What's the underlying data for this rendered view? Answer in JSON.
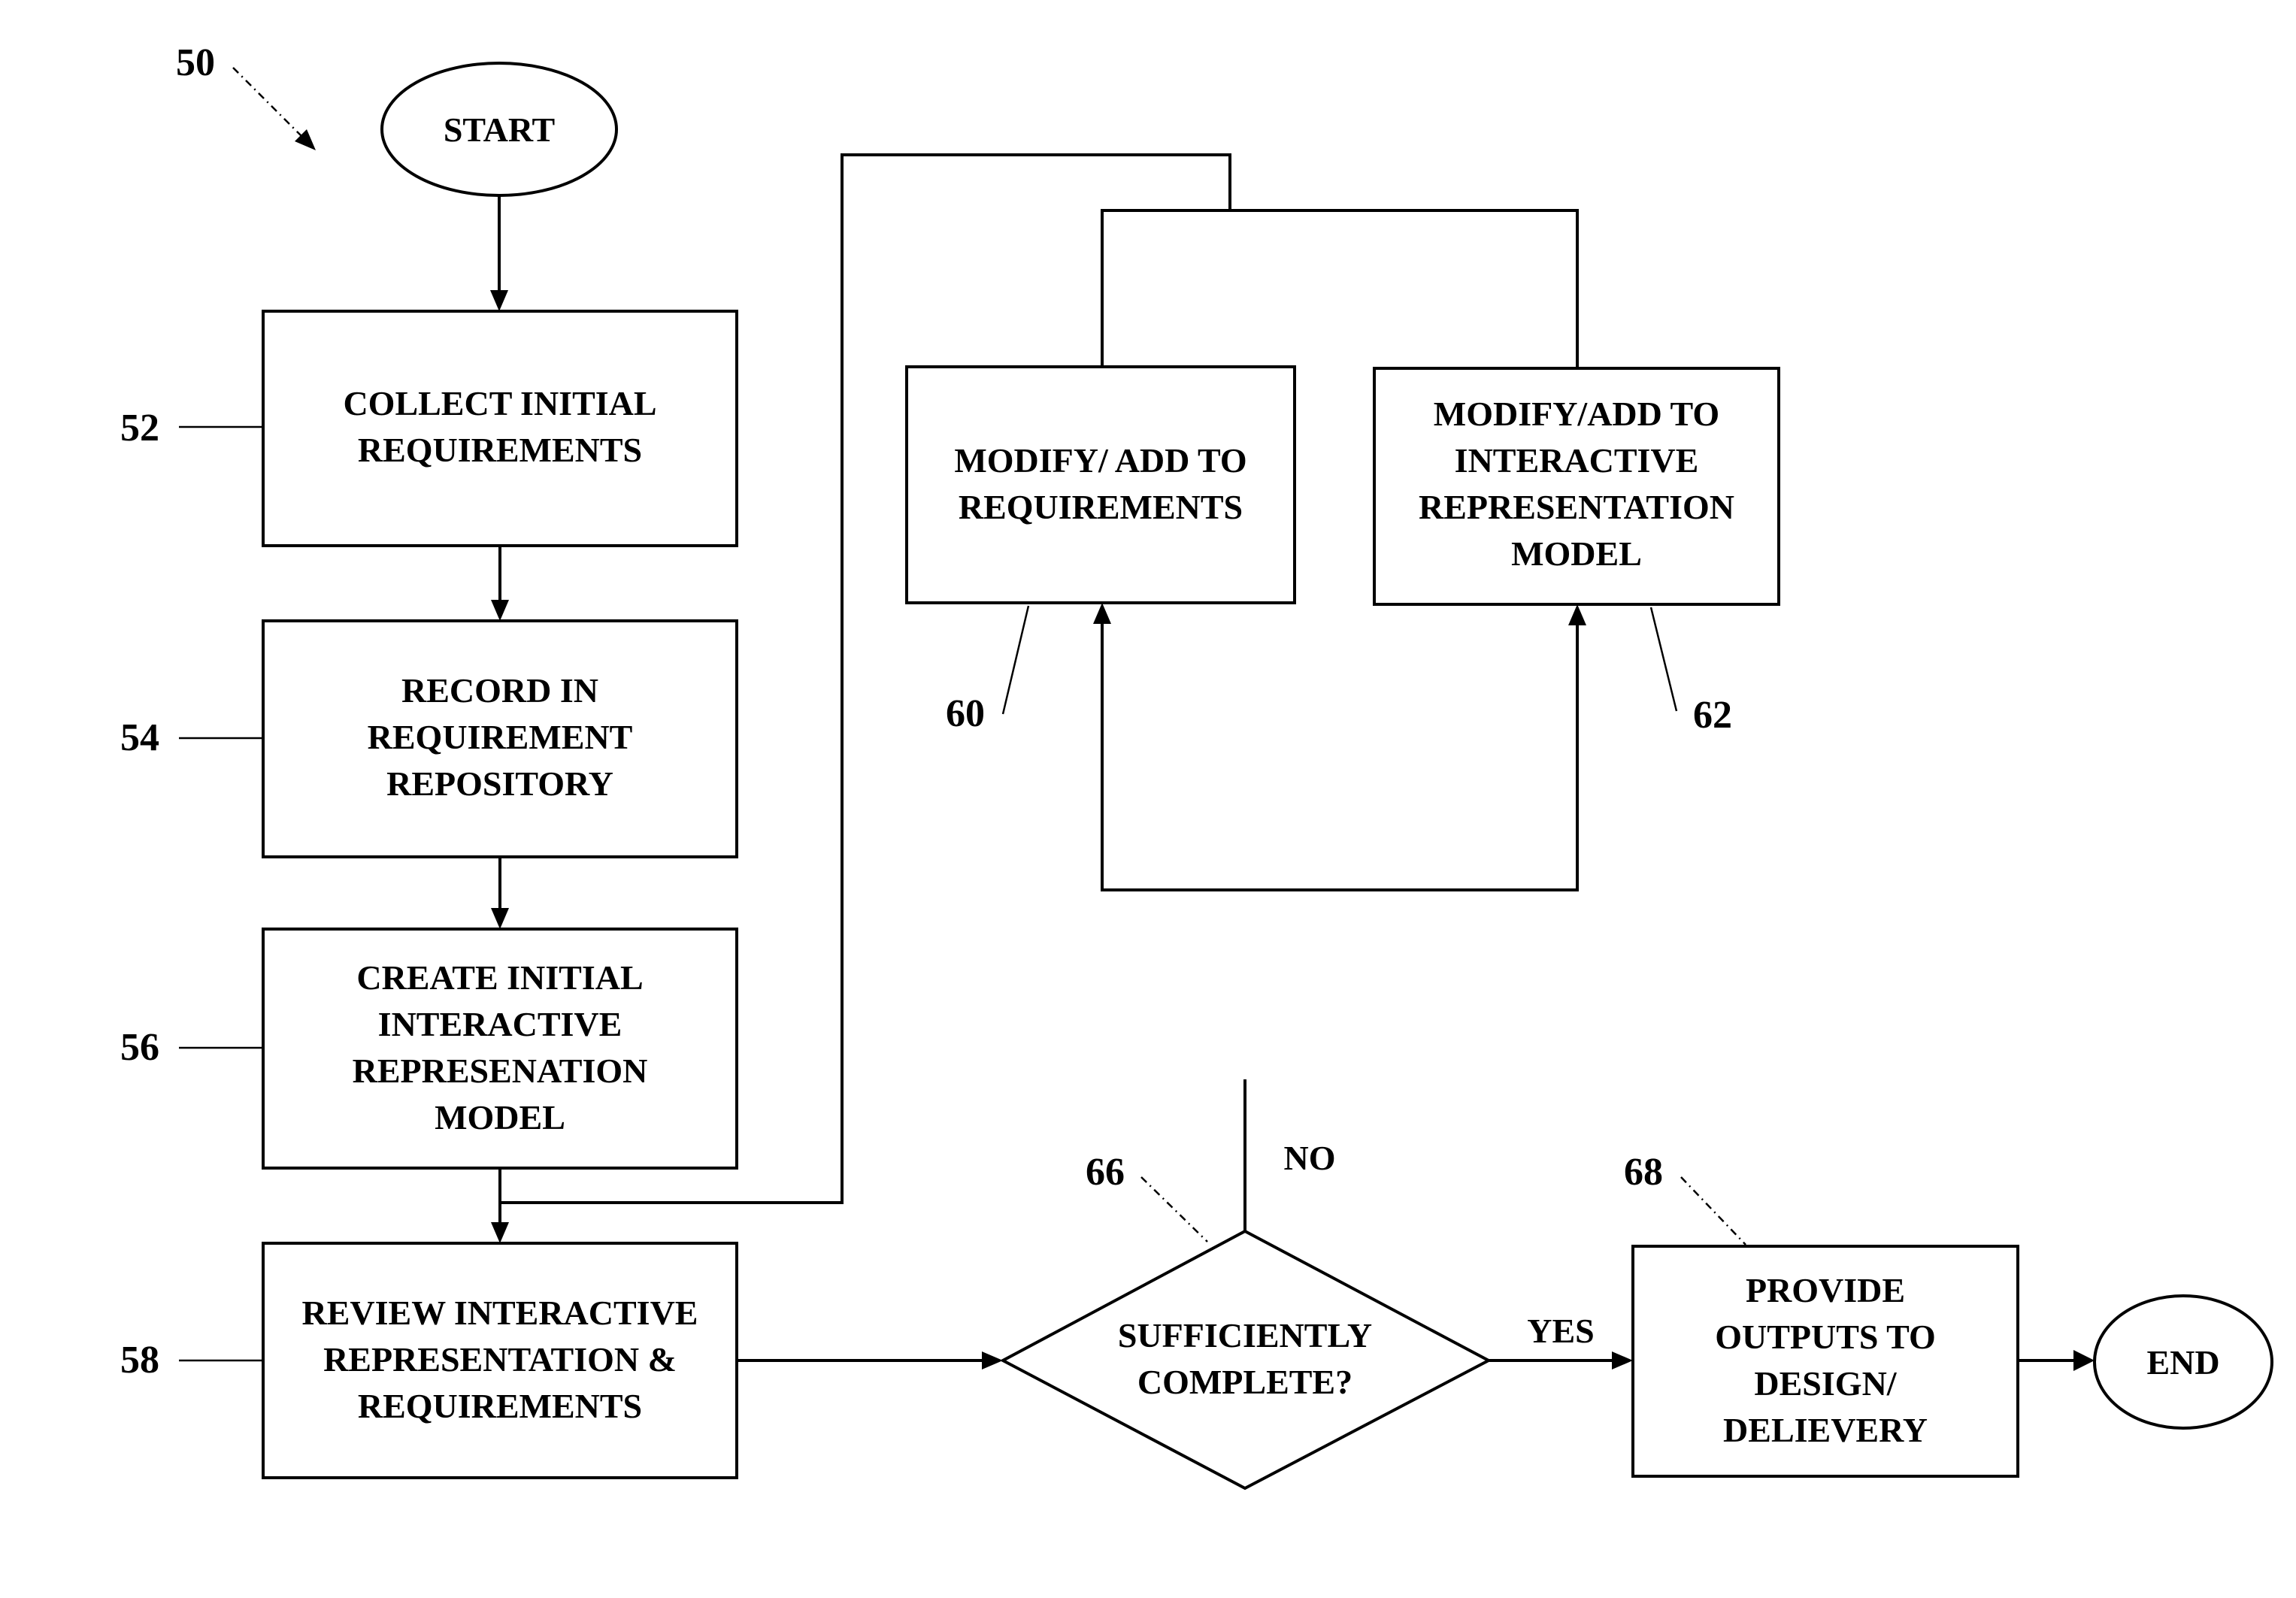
{
  "figure": {
    "reference": "50",
    "nodes": [
      {
        "id": "start",
        "type": "terminal",
        "lines": [
          "START"
        ]
      },
      {
        "id": "52",
        "type": "process",
        "ref": "52",
        "lines": [
          "COLLECT INITIAL",
          "REQUIREMENTS"
        ]
      },
      {
        "id": "54",
        "type": "process",
        "ref": "54",
        "lines": [
          "RECORD IN",
          "REQUIREMENT",
          "REPOSITORY"
        ]
      },
      {
        "id": "56",
        "type": "process",
        "ref": "56",
        "lines": [
          "CREATE INITIAL",
          "INTERACTIVE",
          "REPRESENATION",
          "MODEL"
        ]
      },
      {
        "id": "58",
        "type": "process",
        "ref": "58",
        "lines": [
          "REVIEW INTERACTIVE",
          "REPRESENTATION &",
          "REQUIREMENTS"
        ]
      },
      {
        "id": "60",
        "type": "process",
        "ref": "60",
        "lines": [
          "MODIFY/ ADD TO",
          "REQUIREMENTS"
        ]
      },
      {
        "id": "62",
        "type": "process",
        "ref": "62",
        "lines": [
          "MODIFY/ADD TO",
          "INTERACTIVE",
          "REPRESENTATION",
          "MODEL"
        ]
      },
      {
        "id": "66",
        "type": "decision",
        "ref": "66",
        "lines": [
          "SUFFICIENTLY",
          "COMPLETE?"
        ]
      },
      {
        "id": "68",
        "type": "process",
        "ref": "68",
        "lines": [
          "PROVIDE",
          "OUTPUTS TO",
          "DESIGN/",
          "DELIEVERY"
        ]
      },
      {
        "id": "end",
        "type": "terminal",
        "lines": [
          "END"
        ]
      }
    ],
    "edges": [
      {
        "from": "start",
        "to": "52",
        "label": ""
      },
      {
        "from": "52",
        "to": "54",
        "label": ""
      },
      {
        "from": "54",
        "to": "56",
        "label": ""
      },
      {
        "from": "56",
        "to": "58",
        "label": ""
      },
      {
        "from": "56",
        "to": "60",
        "label": ""
      },
      {
        "from": "56",
        "to": "62",
        "label": ""
      },
      {
        "from": "60",
        "to": "62",
        "label": ""
      },
      {
        "from": "58",
        "to": "66",
        "label": ""
      },
      {
        "from": "66",
        "to": "68",
        "label": "YES"
      },
      {
        "from": "66",
        "to": "60",
        "label": "NO"
      },
      {
        "from": "68",
        "to": "end",
        "label": ""
      }
    ],
    "edge_labels": {
      "yes": "YES",
      "no": "NO"
    }
  }
}
